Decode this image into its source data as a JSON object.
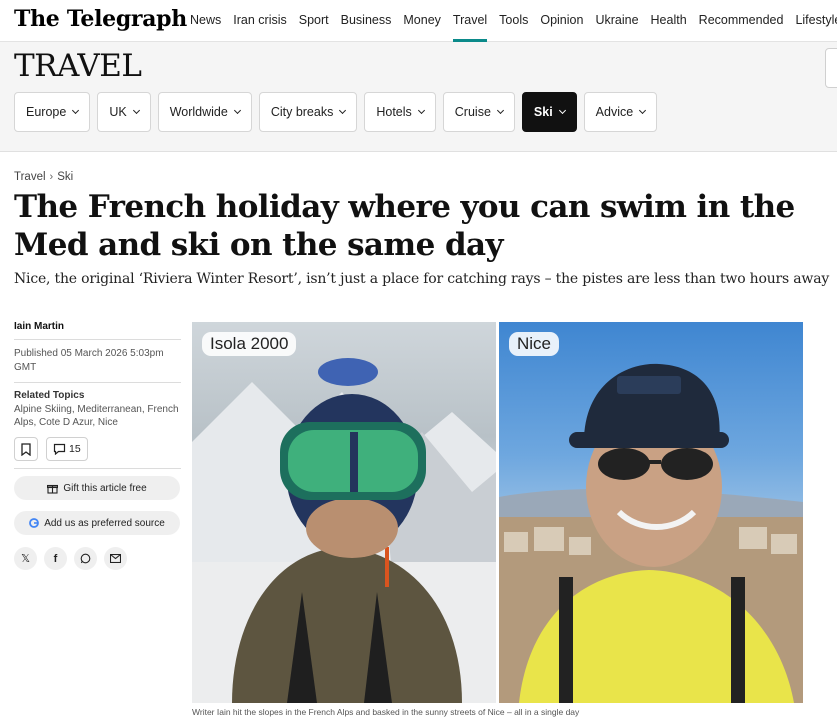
{
  "header": {
    "logo": "The Telegraph",
    "nav": [
      "News",
      "Iran crisis",
      "Sport",
      "Business",
      "Money",
      "Travel",
      "Tools",
      "Opinion",
      "Ukraine",
      "Health",
      "Recommended",
      "Lifestyle"
    ],
    "active_nav": "Travel"
  },
  "section": {
    "title": "TRAVEL",
    "pills": [
      "Europe",
      "UK",
      "Worldwide",
      "City breaks",
      "Hotels",
      "Cruise",
      "Ski",
      "Advice"
    ],
    "active_pill": "Ski"
  },
  "breadcrumb": {
    "root": "Travel",
    "current": "Ski"
  },
  "article": {
    "headline": "The French holiday where you can swim in the Med and ski on the same day",
    "standfirst": "Nice, the original ‘Riviera Winter Resort’, isn’t just a place for catching rays – the pistes are less than two hours away",
    "author": "Iain Martin",
    "published": "Published 05 March 2026 5:03pm GMT",
    "related_label": "Related Topics",
    "topics": "Alpine Skiing, Mediterranean, French Alps, Cote D Azur, Nice",
    "comment_count": "15",
    "gift_label": "Gift this article free",
    "google_label": "Add us as preferred source"
  },
  "hero": {
    "left_label": "Isola 2000",
    "right_label": "Nice",
    "caption": "Writer Iain hit the slopes in the French Alps and basked in the sunny streets of Nice – all in a single day"
  },
  "colors": {
    "accent": "#0b8a8a",
    "pill_active": "#111111",
    "section_bg": "#f5f5f5"
  },
  "icons": [
    "bookmark-icon",
    "comment-icon",
    "gift-icon",
    "google-icon",
    "x-icon",
    "facebook-icon",
    "whatsapp-icon",
    "email-icon"
  ]
}
